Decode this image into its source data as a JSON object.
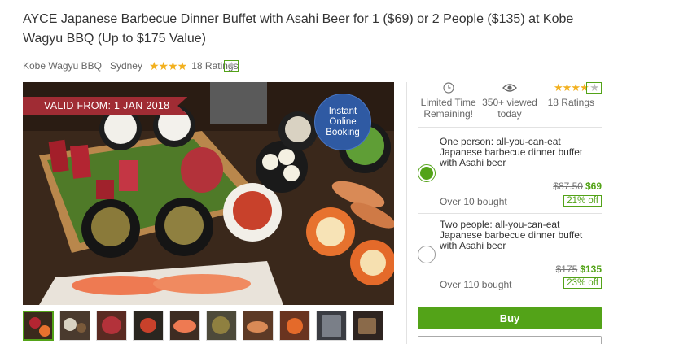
{
  "deal": {
    "title": "AYCE Japanese Barbecue Dinner Buffet with Asahi Beer for 1 ($69) or 2 People ($135) at Kobe Wagyu BBQ (Up to $175 Value)",
    "merchant": "Kobe Wagyu BBQ",
    "location": "Sydney",
    "rating_stars": 4,
    "ratings_text": "18 Ratings"
  },
  "hero": {
    "valid_from": "VALID FROM: 1 JAN 2018",
    "badge_line1": "Instant",
    "badge_line2": "Online",
    "badge_line3": "Booking"
  },
  "thumbnails": {
    "count": 10,
    "selected_index": 0
  },
  "stats": {
    "time_line1": "Limited Time",
    "time_line2": "Remaining!",
    "viewed_line1": "350+ viewed",
    "viewed_line2": "today",
    "ratings": "18 Ratings",
    "stars": 4
  },
  "options": [
    {
      "text": "One person: all-you-can-eat Japanese barbecue dinner buffet with Asahi beer",
      "old_price": "$87.50",
      "new_price": "$69",
      "bought": "Over 10 bought",
      "discount": "21% off",
      "selected": true
    },
    {
      "text": "Two people: all-you-can-eat Japanese barbecue dinner buffet with Asahi beer",
      "old_price": "$175",
      "new_price": "$135",
      "bought": "Over 110 bought",
      "discount": "23% off",
      "selected": false
    }
  ],
  "buy_label": "Buy",
  "colors": {
    "accent": "#53a318",
    "banner": "#a02c34",
    "badge": "#2f5aa3",
    "star": "#f2b01e"
  },
  "icons": [
    "clock-icon",
    "eye-icon",
    "star-icon"
  ]
}
